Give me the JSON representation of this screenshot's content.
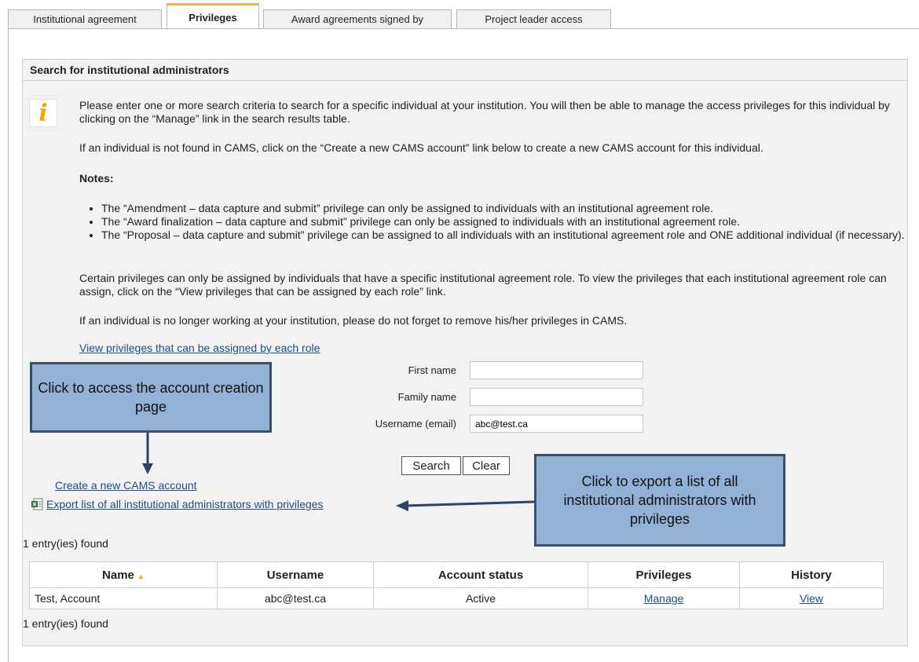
{
  "tabs": [
    {
      "label": "Institutional agreement"
    },
    {
      "label": "Privileges"
    },
    {
      "label": "Award agreements signed by"
    },
    {
      "label": "Project leader access"
    }
  ],
  "panel": {
    "title": "Search for institutional administrators",
    "info_icon": "info-icon",
    "intro": "Please enter one or more search criteria to search for a specific individual at your institution. You will then be able to manage the access privileges for this individual by clicking on the “Manage” link in the search results table.",
    "not_found": "If an individual is not found in CAMS, click on the “Create a new CAMS account” link below to create a new CAMS account for this individual.",
    "notes_title": "Notes:",
    "notes": [
      "The “Amendment – data capture and submit” privilege can only be assigned to individuals with an institutional agreement role.",
      "The “Award finalization – data capture and submit” privilege can only be assigned to individuals with an institutional agreement role.",
      "The “Proposal – data capture and submit” privilege can be assigned to all individuals with an institutional agreement role and ONE additional individual (if necessary)."
    ],
    "certain": "Certain privileges can only be assigned by individuals that have a specific institutional agreement role. To view the privileges that each institutional agreement role can assign, click on the “View privileges that can be assigned by each role” link.",
    "no_longer": "If an individual is no longer working at your institution, please do not forget to remove his/her privileges in CAMS.",
    "view_link": "View privileges that can be assigned by each role"
  },
  "form": {
    "first_name_label": "First name",
    "first_name_value": "",
    "family_name_label": "Family name",
    "family_name_value": "",
    "username_label": "Username (email)",
    "username_value": "abc@test.ca",
    "search_label": "Search",
    "clear_label": "Clear"
  },
  "links": {
    "create_account": "Create a new CAMS account",
    "export": "Export list of all institutional administrators with privileges",
    "export_icon": "excel-icon"
  },
  "results": {
    "count_top": "1 entry(ies) found",
    "count_bottom": "1 entry(ies) found",
    "columns": [
      "Name",
      "Username",
      "Account status",
      "Privileges",
      "History"
    ],
    "rows": [
      {
        "name": "Test, Account",
        "username": "abc@test.ca",
        "status": "Active",
        "privileges": "Manage",
        "history": "View"
      }
    ]
  },
  "callouts": {
    "create": "Click to access the account creation page",
    "export": "Click to export a list of all institutional administrators with privileges"
  },
  "colors": {
    "tab_accent": "#f3b04a",
    "callout_fill": "#93b1d4",
    "callout_border": "#3b4f6b",
    "link": "#1a4f8a",
    "panel_bg": "#f2f2f2"
  }
}
